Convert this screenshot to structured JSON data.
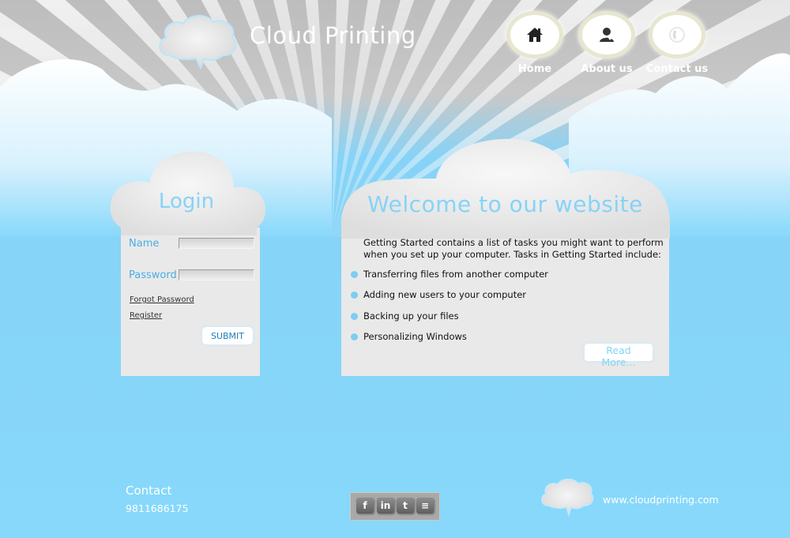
{
  "header": {
    "site_title": "Cloud Printing",
    "nav": [
      {
        "label": "Home",
        "icon": "home-icon"
      },
      {
        "label": "About us",
        "icon": "user-icon"
      },
      {
        "label": "Contact us",
        "icon": "phone-icon"
      }
    ]
  },
  "login": {
    "title": "Login",
    "name_label": "Name",
    "password_label": "Password",
    "name_value": "",
    "password_value": "",
    "forgot_link": "Forgot Password",
    "register_link": "Register",
    "submit_label": "SUBMIT"
  },
  "welcome": {
    "title": "Welcome to our website",
    "intro": "Getting Started contains a list of tasks you might want to perform when you set up your computer. Tasks in Getting Started include:",
    "tasks": [
      "Transferring files from another computer",
      "Adding new users to your computer",
      "Backing up your files",
      "Personalizing Windows"
    ],
    "read_more": "Read More..."
  },
  "footer": {
    "contact_title": "Contact",
    "phone": "9811686175",
    "social": [
      {
        "name": "facebook-icon",
        "glyph": "f"
      },
      {
        "name": "linkedin-icon",
        "glyph": "in"
      },
      {
        "name": "twitter-icon",
        "glyph": "t"
      },
      {
        "name": "rss-icon",
        "glyph": "≡"
      }
    ],
    "url": "www.cloudprinting.com"
  },
  "colors": {
    "sky": "#87d8fb",
    "accent_text": "#86d3f7",
    "panel": "#e9e9e9",
    "header_gray": "#c4c4c4"
  }
}
